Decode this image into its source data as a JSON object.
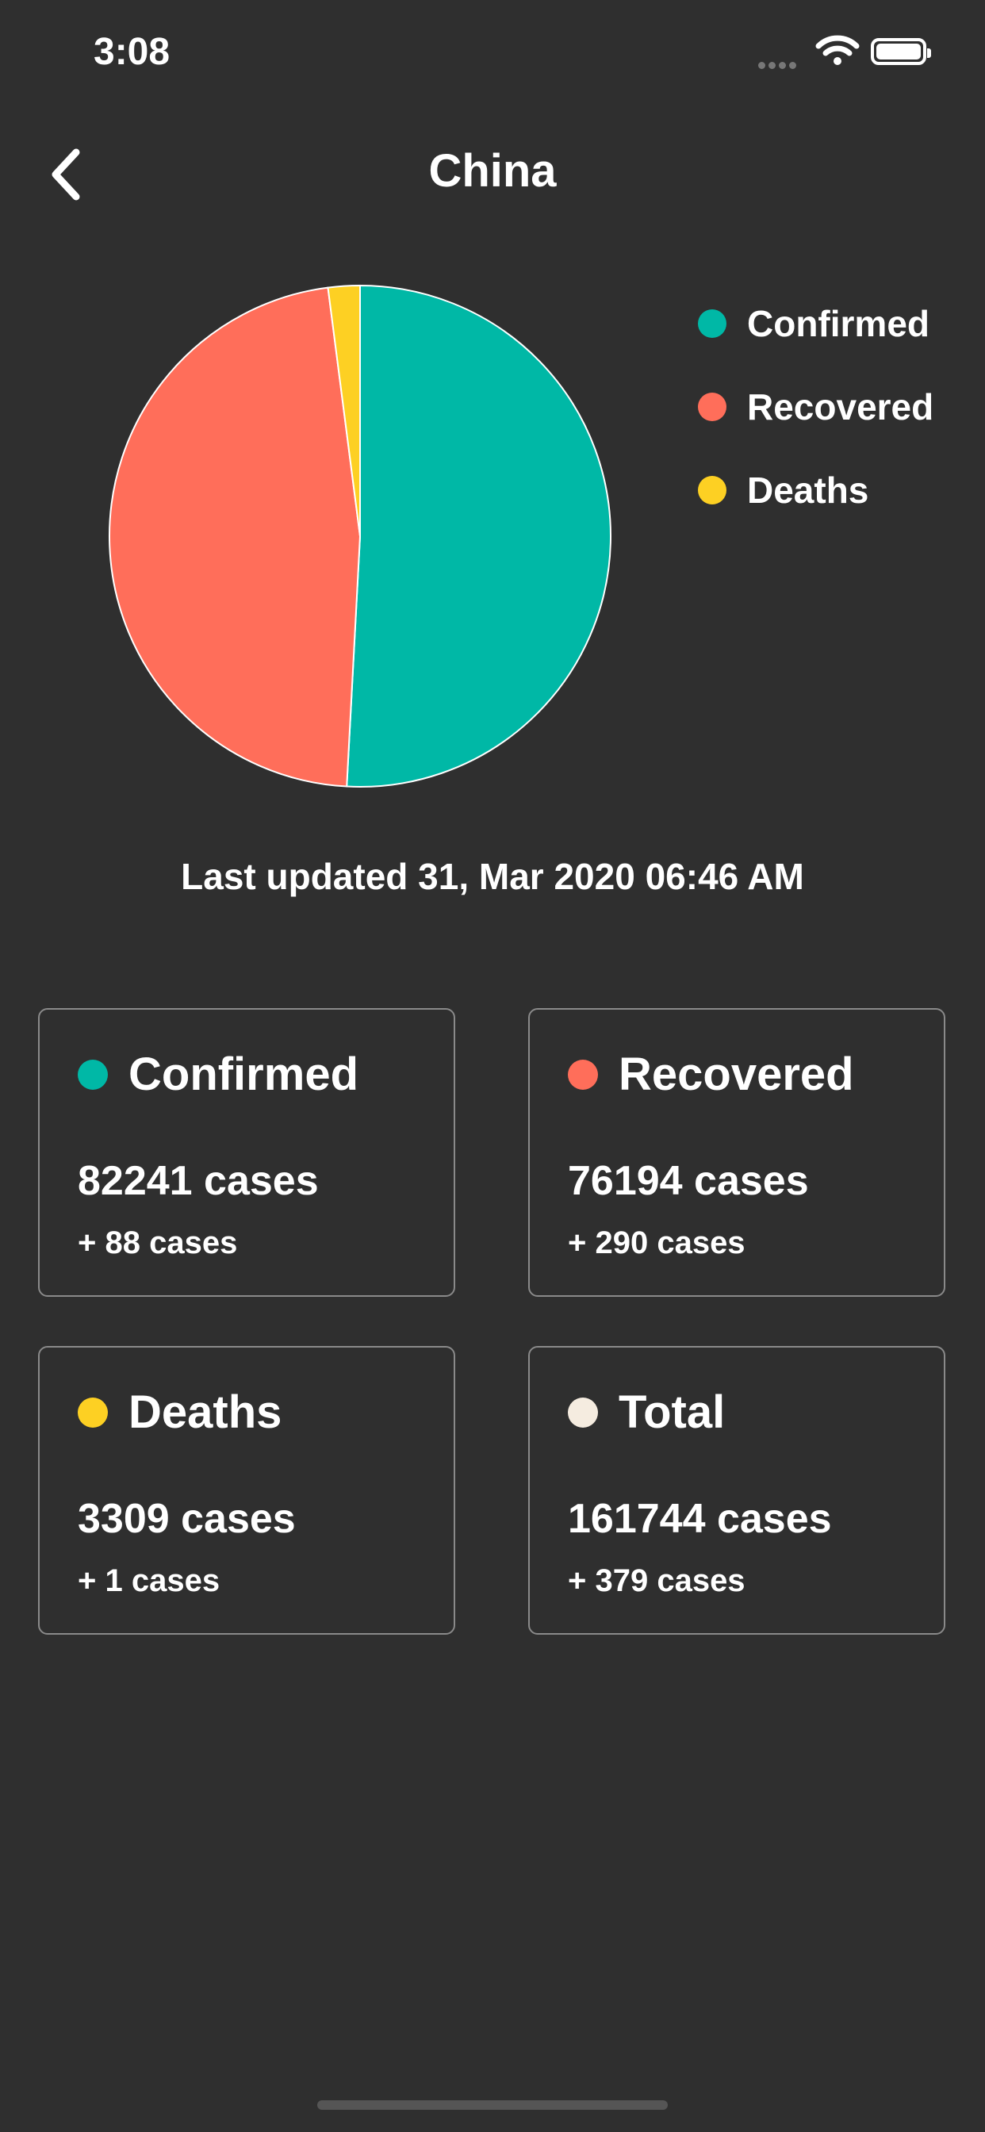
{
  "status_bar": {
    "time": "3:08"
  },
  "header": {
    "title": "China",
    "back_icon": "chevron-left-icon"
  },
  "colors": {
    "background": "#2f2f2f",
    "confirmed": "#00b8a6",
    "recovered": "#ff6e5a",
    "deaths": "#fdd023",
    "total": "#f5ece0"
  },
  "chart_data": {
    "type": "pie",
    "categories": [
      "Confirmed",
      "Recovered",
      "Deaths"
    ],
    "values": [
      82241,
      76194,
      3309
    ],
    "colors": [
      "#00b8a6",
      "#ff6e5a",
      "#fdd023"
    ],
    "legend_position": "right"
  },
  "last_updated": "Last updated 31, Mar 2020 06:46 AM",
  "cards": [
    {
      "title": "Confirmed",
      "cases": "82241 cases",
      "delta": "+ 88 cases",
      "color": "#00b8a6"
    },
    {
      "title": "Recovered",
      "cases": "76194 cases",
      "delta": "+ 290 cases",
      "color": "#ff6e5a"
    },
    {
      "title": "Deaths",
      "cases": "3309 cases",
      "delta": "+ 1 cases",
      "color": "#fdd023"
    },
    {
      "title": "Total",
      "cases": "161744 cases",
      "delta": "+ 379 cases",
      "color": "#f5ece0"
    }
  ]
}
